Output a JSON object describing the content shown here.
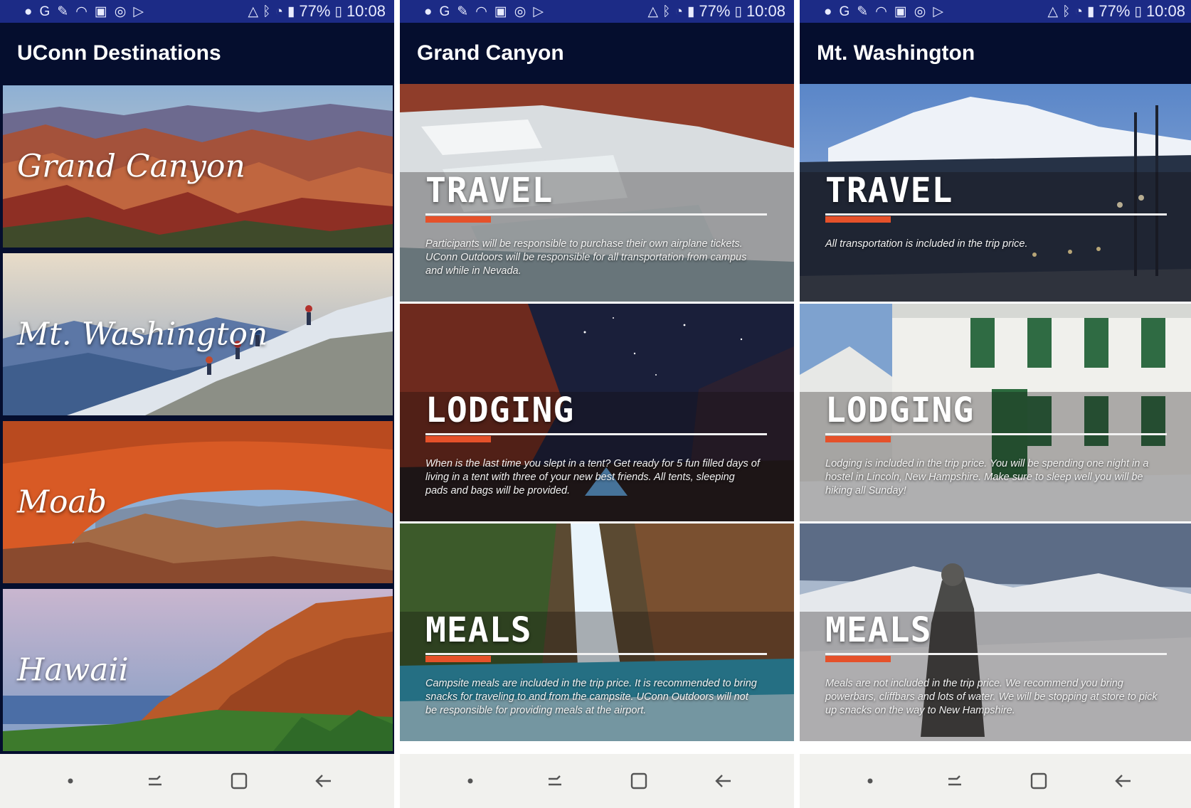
{
  "status_bar": {
    "battery": "77%",
    "time": "10:08"
  },
  "phones": [
    {
      "title": "UConn Destinations",
      "destinations": [
        {
          "name": "Grand Canyon"
        },
        {
          "name": "Mt. Washington"
        },
        {
          "name": "Moab"
        },
        {
          "name": "Hawaii"
        }
      ]
    },
    {
      "title": "Grand Canyon",
      "sections": [
        {
          "heading": "TRAVEL",
          "text": "Participants will be responsible to purchase their own airplane tickets. UConn Outdoors will be responsible for all transportation from campus and while in Nevada."
        },
        {
          "heading": "LODGING",
          "text": "When is the last time you slept in a tent? Get ready for 5 fun filled days of living in a tent with three of your new best friends. All tents, sleeping pads and bags will be provided."
        },
        {
          "heading": "MEALS",
          "text": "Campsite meals are included in the trip price. It is recommended to bring snacks for traveling to and from the campsite. UConn Outdoors will not be responsible for providing meals at the airport."
        }
      ]
    },
    {
      "title": "Mt. Washington",
      "sections": [
        {
          "heading": "TRAVEL",
          "text": "All transportation is included in the trip price."
        },
        {
          "heading": "LODGING",
          "text": "Lodging is included in the trip price. You will be spending one night in a hostel in Lincoln, New Hampshire. Make sure to sleep well you will be hiking all Sunday!"
        },
        {
          "heading": "MEALS",
          "text": "Meals are not included in the trip price. We recommend you bring powerbars, cliffbars and lots of water. We will be stopping at store to pick up snacks on the way to New Hampshire."
        }
      ]
    }
  ],
  "colors": {
    "status_bar": "#1c2b86",
    "app_bar": "#050e2e",
    "accent": "#e5512a",
    "nav_bar": "#f1f1ee"
  }
}
